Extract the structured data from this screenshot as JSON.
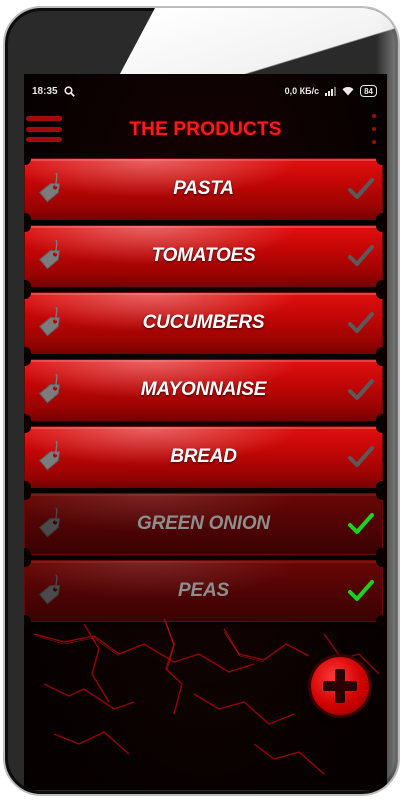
{
  "status_bar": {
    "time": "18:35",
    "network_speed": "0,0 КБ/с",
    "battery": "84"
  },
  "app_bar": {
    "title": "THE PRODUCTS"
  },
  "products": [
    {
      "name": "PASTA",
      "checked": false
    },
    {
      "name": "TOMATOES",
      "checked": false
    },
    {
      "name": "CUCUMBERS",
      "checked": false
    },
    {
      "name": "MAYONNAISE",
      "checked": false
    },
    {
      "name": "BREAD",
      "checked": false
    },
    {
      "name": "GREEN ONION",
      "checked": true
    },
    {
      "name": "PEAS",
      "checked": true
    }
  ],
  "icons": {
    "menu": "hamburger-menu-icon",
    "more": "more-vertical-icon",
    "item": "price-tag-icon",
    "check": "checkmark-icon",
    "add": "plus-icon"
  },
  "colors": {
    "accent": "#ff1a1a",
    "item_active": "#c20606",
    "item_done": "#520404",
    "check_unchecked": "#5a5a5a",
    "check_checked": "#1fd11f"
  }
}
